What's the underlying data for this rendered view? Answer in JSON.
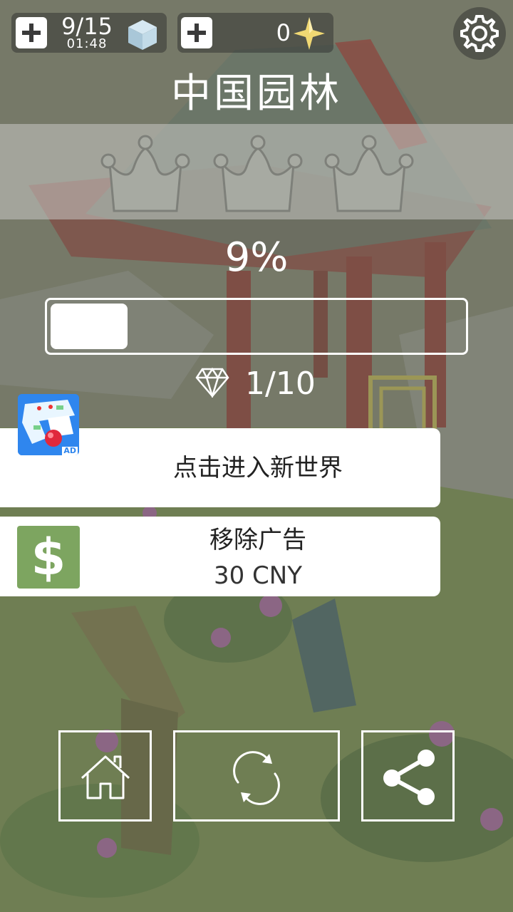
{
  "top_bar": {
    "lives": "9/15",
    "lives_timer": "01:48",
    "gems": "0",
    "icons": [
      "plus-icon",
      "cube-icon",
      "sparkle-star-icon",
      "gear-icon"
    ]
  },
  "level": {
    "title": "中国园林",
    "crowns_total": 3,
    "crowns_earned": 0,
    "progress_label": "9%",
    "progress_fraction": 0.09,
    "diamonds": "1/10"
  },
  "cards": {
    "ad_label": "点击进入新世界",
    "ad_badge": "AD",
    "remove_ads_title": "移除广告",
    "remove_ads_price": "30 CNY",
    "dollar_symbol": "$"
  },
  "nav": {
    "icons": [
      "home-icon",
      "restart-icon",
      "share-icon"
    ]
  },
  "colors": {
    "accent_green": "#7da560",
    "ad_blue": "#2b7fe6",
    "card_bg": "#ffffff"
  }
}
